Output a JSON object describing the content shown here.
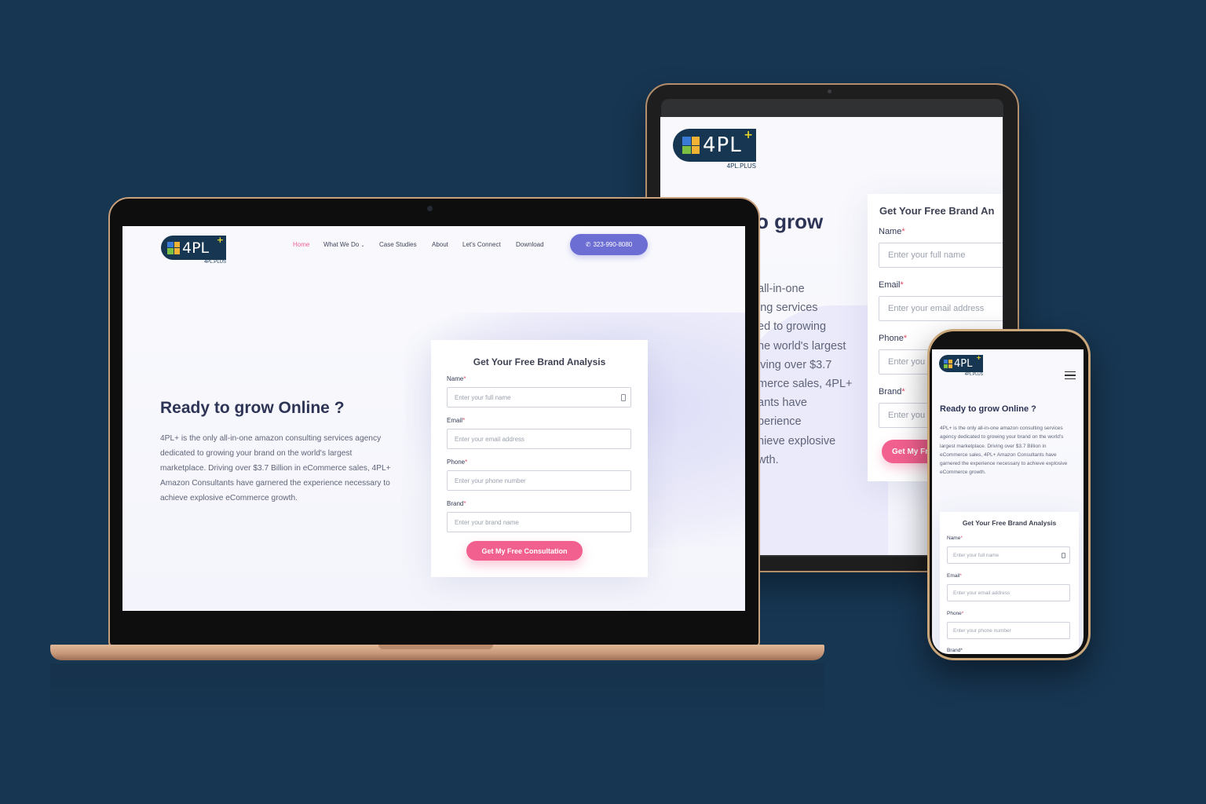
{
  "brand": {
    "logo_text": "4PL",
    "logo_plus": "+",
    "logo_sub": "4PL.PLUS",
    "colors": {
      "navy": "#163651",
      "accent_pink": "#f2608f",
      "accent_purple": "#6c6ed4",
      "background": "#173652"
    }
  },
  "nav": {
    "items": [
      {
        "label": "Home",
        "active": true
      },
      {
        "label": "What We Do"
      },
      {
        "label": "Case Studies"
      },
      {
        "label": "About"
      },
      {
        "label": "Let's Connect"
      },
      {
        "label": "Download"
      }
    ],
    "dropdown_icon": "chevron-down-icon",
    "phone_label": "323-990-8080",
    "phone_icon": "phone-icon",
    "menu_icon": "hamburger-menu-icon"
  },
  "hero": {
    "heading": "Ready to grow Online ?",
    "paragraph": "4PL+ is the only all-in-one amazon consulting services agency dedicated to growing your brand on the world's largest marketplace. Driving over $3.7 Billion in eCommerce sales, 4PL+ Amazon Consultants have garnered the experience necessary to achieve explosive eCommerce growth.",
    "tablet_heading_fragment": "o grow",
    "tablet_lines": [
      "all-in-one",
      "ing services",
      "ed to growing",
      "he world's largest",
      "iving over $3.7",
      "merce sales, 4PL+",
      "ants have",
      "perience",
      "hieve explosive",
      "wth."
    ]
  },
  "form": {
    "title": "Get Your Free Brand Analysis",
    "tablet_title_fragment": "Get Your Free Brand An",
    "fields": [
      {
        "label": "Name",
        "placeholder": "Enter your full name"
      },
      {
        "label": "Email",
        "placeholder": "Enter your email address"
      },
      {
        "label": "Phone",
        "placeholder": "Enter your phone number"
      },
      {
        "label": "Brand",
        "placeholder": "Enter your brand name"
      }
    ],
    "required_mark": "*",
    "tablet_placeholder_fragments": [
      "Enter you",
      "Enter you"
    ],
    "phone_cutoff_label": "Brand*",
    "submit_label": "Get My Free Consultation",
    "tablet_submit_fragment": "Get My Fr",
    "field_icon": "contact-card-icon"
  }
}
